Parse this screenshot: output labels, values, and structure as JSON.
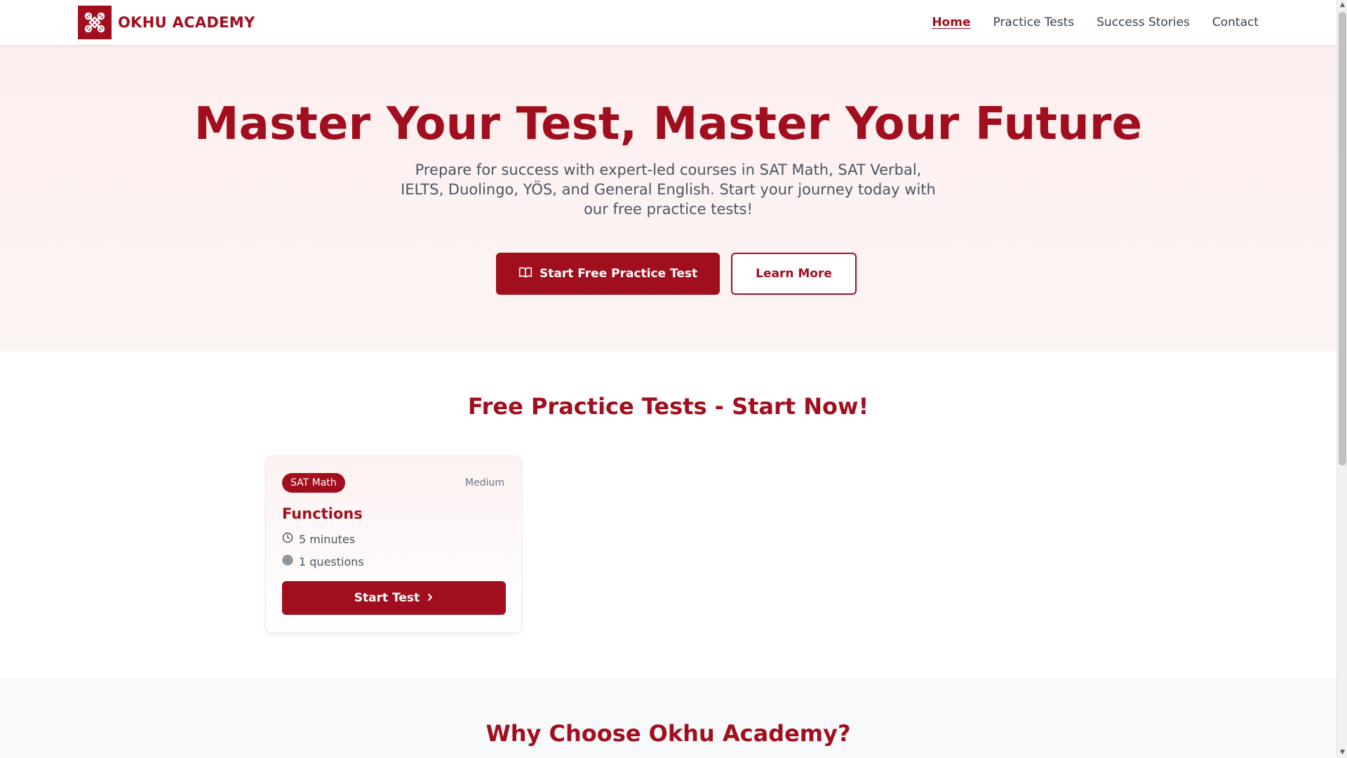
{
  "header": {
    "brand": "OKHU ACADEMY",
    "nav": {
      "home": "Home",
      "practice_tests": "Practice Tests",
      "success_stories": "Success Stories",
      "contact": "Contact"
    },
    "active_nav": "home"
  },
  "hero": {
    "title": "Master Your Test, Master Your Future",
    "subtitle": "Prepare for success with expert-led courses in SAT Math, SAT Verbal, IELTS, Duolingo, YÖS, and General English. Start your journey today with our free practice tests!",
    "primary_button": "Start Free Practice Test",
    "secondary_button": "Learn More"
  },
  "practice": {
    "title": "Free Practice Tests - Start Now!",
    "card": {
      "badge": "SAT Math",
      "difficulty": "Medium",
      "title": "Functions",
      "time": "5 minutes",
      "questions": "1 questions",
      "button": "Start Test"
    }
  },
  "why": {
    "title": "Why Choose Okhu Academy?"
  },
  "colors": {
    "brand": "#a10f1e",
    "hero_bg": "#fdf2f2",
    "why_bg": "#f8f9fb"
  },
  "icons": {
    "logo": "knot-logo-icon",
    "primary_button": "open-book-icon",
    "time": "clock-icon",
    "questions": "target-icon",
    "card_button": "chevron-right-icon"
  }
}
